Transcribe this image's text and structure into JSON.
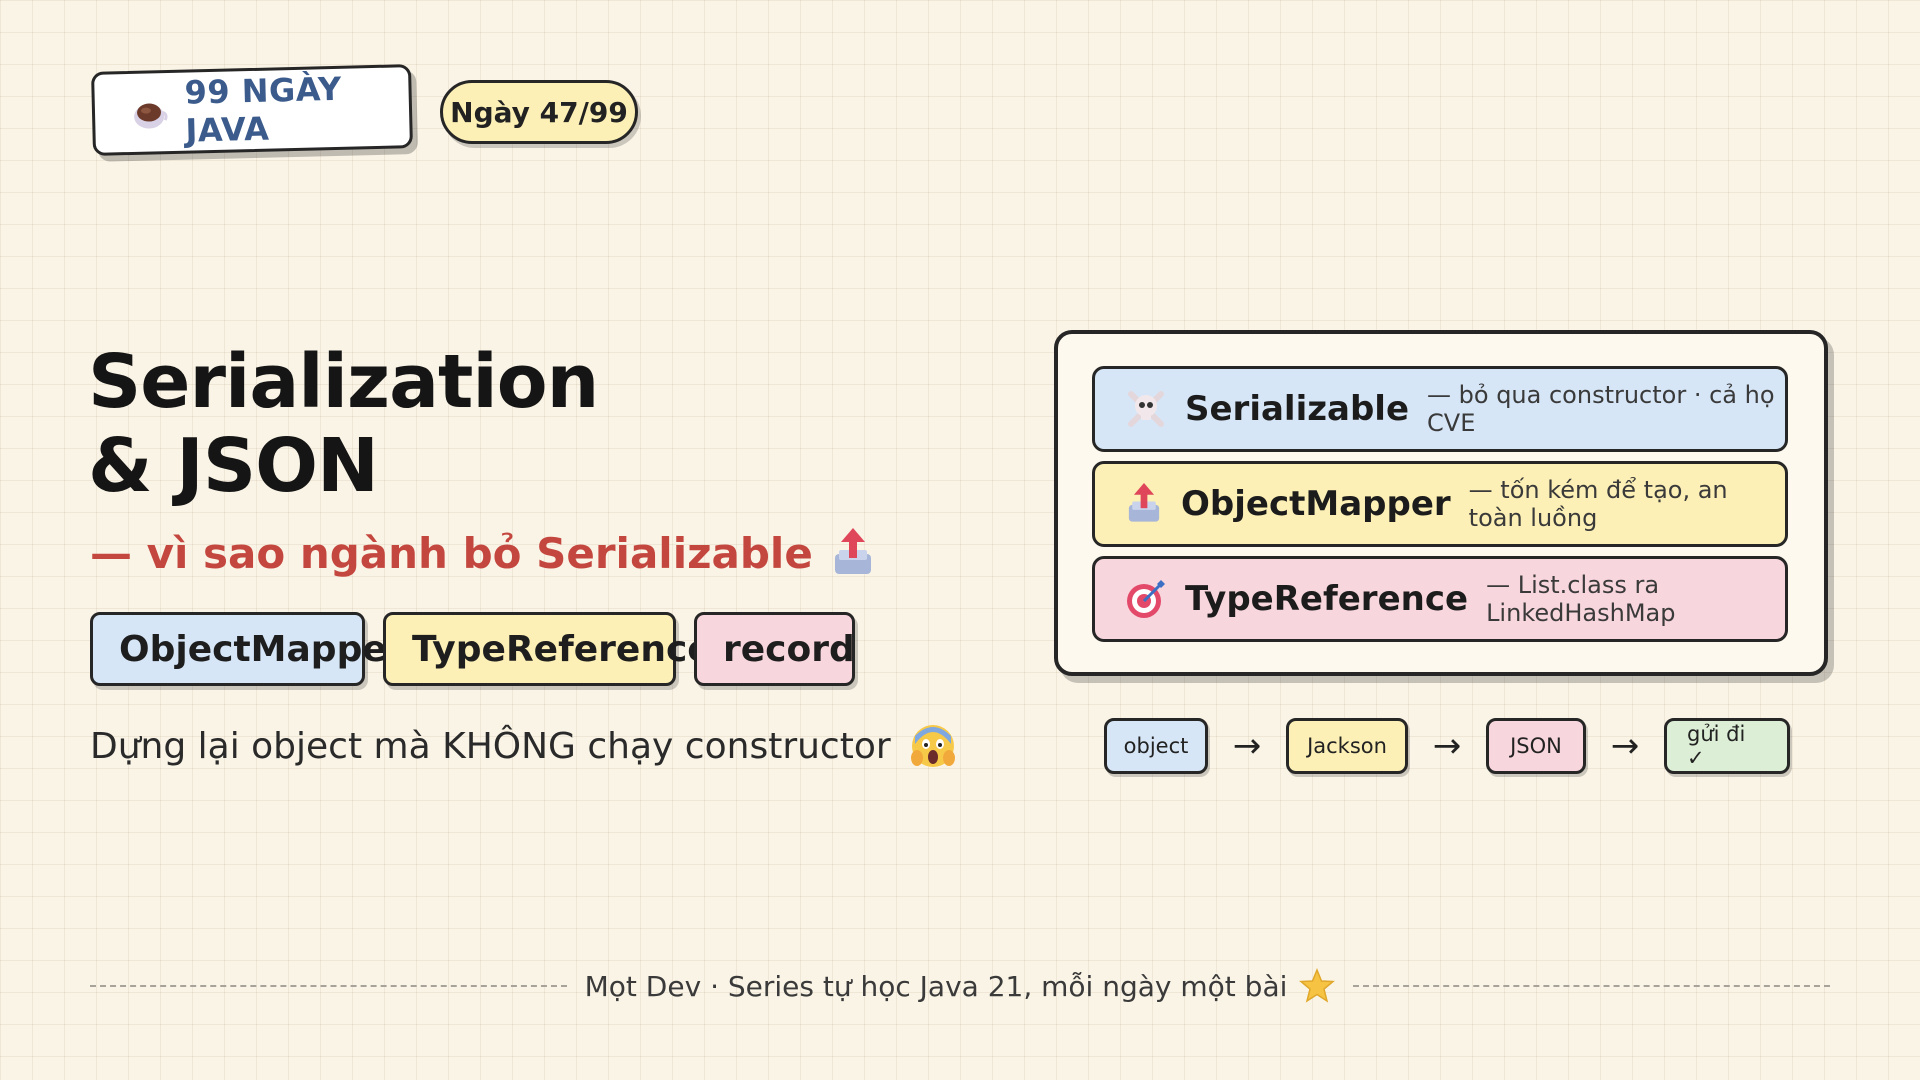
{
  "header": {
    "brand_label": "99 NGÀY JAVA",
    "brand_icon": "coffee-cup-icon",
    "day_label": "Ngày 47/99"
  },
  "main": {
    "title_line1": "Serialization",
    "title_line2": "& JSON",
    "subtitle": "— vì sao ngành bỏ Serializable",
    "subtitle_icon": "outbox-tray-icon",
    "tags": [
      "ObjectMapper",
      "TypeReference",
      "record"
    ],
    "description": "Dựng lại object mà KHÔNG chạy constructor",
    "description_icon": "screaming-face-icon"
  },
  "card": {
    "rows": [
      {
        "icon": "skull-crossbones-icon",
        "name": "Serializable",
        "note": "— bỏ qua constructor · cả họ CVE"
      },
      {
        "icon": "outbox-tray-icon",
        "name": "ObjectMapper",
        "note": "— tốn kém để tạo, an toàn luồng"
      },
      {
        "icon": "target-icon",
        "name": "TypeReference",
        "note": "— List.class ra LinkedHashMap"
      }
    ]
  },
  "flow": {
    "nodes": [
      "object",
      "Jackson",
      "JSON",
      "gửi đi ✓"
    ],
    "arrow": "→"
  },
  "footer": {
    "text": "Mọt Dev · Series tự học Java 21, mỗi ngày một bài",
    "icon": "star-icon"
  },
  "colors": {
    "background": "#faf4e6",
    "brand_text": "#3b5b8c",
    "subtitle": "#c4473f",
    "blue": "#d6e6f7",
    "yellow": "#fcf0b6",
    "pink": "#f8d6dd",
    "green": "#dcefd6"
  }
}
